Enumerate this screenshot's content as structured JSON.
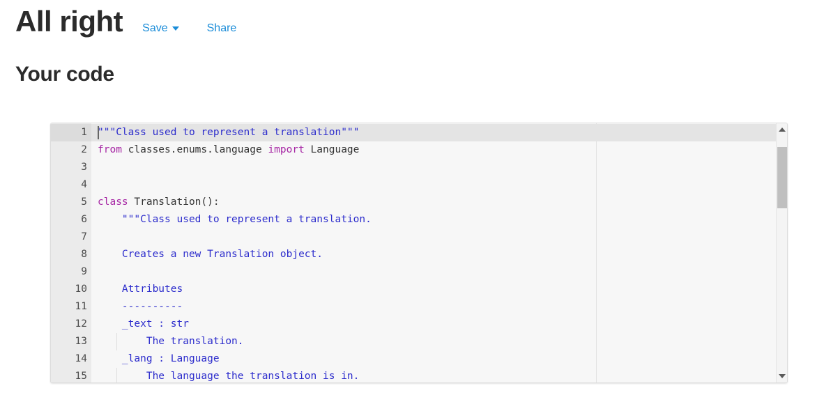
{
  "header": {
    "title": "All right",
    "actions": {
      "save_label": "Save",
      "save_caret_icon": "chevron-down-icon",
      "share_label": "Share"
    }
  },
  "section": {
    "title": "Your code"
  },
  "editor": {
    "language": "python",
    "active_line": 1,
    "cursor": {
      "line": 1,
      "column": 1
    },
    "gutter": {
      "line_numbers": [
        "1",
        "2",
        "3",
        "4",
        "5",
        "6",
        "7",
        "8",
        "9",
        "10",
        "11",
        "12",
        "13",
        "14",
        "15"
      ],
      "fold_marker_lines": [
        5
      ],
      "fold_icon": "triangle-down-icon"
    },
    "scrollbar": {
      "up_arrow_icon": "arrow-up-icon",
      "down_arrow_icon": "arrow-down-icon",
      "thumb_top_pct": 5,
      "thumb_height_pct": 26
    },
    "lines": [
      {
        "n": 1,
        "indent_guides": [],
        "tokens": [
          {
            "t": "\"\"\"Class used to represent a translation\"\"\"",
            "c": "tok-str"
          }
        ]
      },
      {
        "n": 2,
        "indent_guides": [],
        "tokens": [
          {
            "t": "from",
            "c": "tok-kw"
          },
          {
            "t": " classes.enums.language ",
            "c": "tok-txt"
          },
          {
            "t": "import",
            "c": "tok-kw"
          },
          {
            "t": " Language",
            "c": "tok-txt"
          }
        ]
      },
      {
        "n": 3,
        "indent_guides": [],
        "tokens": []
      },
      {
        "n": 4,
        "indent_guides": [],
        "tokens": []
      },
      {
        "n": 5,
        "indent_guides": [],
        "tokens": [
          {
            "t": "class",
            "c": "tok-kw"
          },
          {
            "t": " Translation():",
            "c": "tok-txt"
          }
        ]
      },
      {
        "n": 6,
        "indent_guides": [],
        "tokens": [
          {
            "t": "    \"\"\"Class used to represent a translation.",
            "c": "tok-str"
          }
        ]
      },
      {
        "n": 7,
        "indent_guides": [],
        "tokens": []
      },
      {
        "n": 8,
        "indent_guides": [],
        "tokens": [
          {
            "t": "    Creates a new Translation object.",
            "c": "tok-str"
          }
        ]
      },
      {
        "n": 9,
        "indent_guides": [],
        "tokens": []
      },
      {
        "n": 10,
        "indent_guides": [],
        "tokens": [
          {
            "t": "    Attributes",
            "c": "tok-str"
          }
        ]
      },
      {
        "n": 11,
        "indent_guides": [],
        "tokens": [
          {
            "t": "    ----------",
            "c": "tok-str"
          }
        ]
      },
      {
        "n": 12,
        "indent_guides": [],
        "tokens": [
          {
            "t": "    _text : str",
            "c": "tok-str"
          }
        ]
      },
      {
        "n": 13,
        "indent_guides": [
          36
        ],
        "tokens": [
          {
            "t": "        The translation.",
            "c": "tok-str"
          }
        ]
      },
      {
        "n": 14,
        "indent_guides": [],
        "tokens": [
          {
            "t": "    _lang : Language",
            "c": "tok-str"
          }
        ]
      },
      {
        "n": 15,
        "indent_guides": [
          36
        ],
        "tokens": [
          {
            "t": "        The language the translation is in.",
            "c": "tok-str"
          }
        ]
      }
    ]
  }
}
